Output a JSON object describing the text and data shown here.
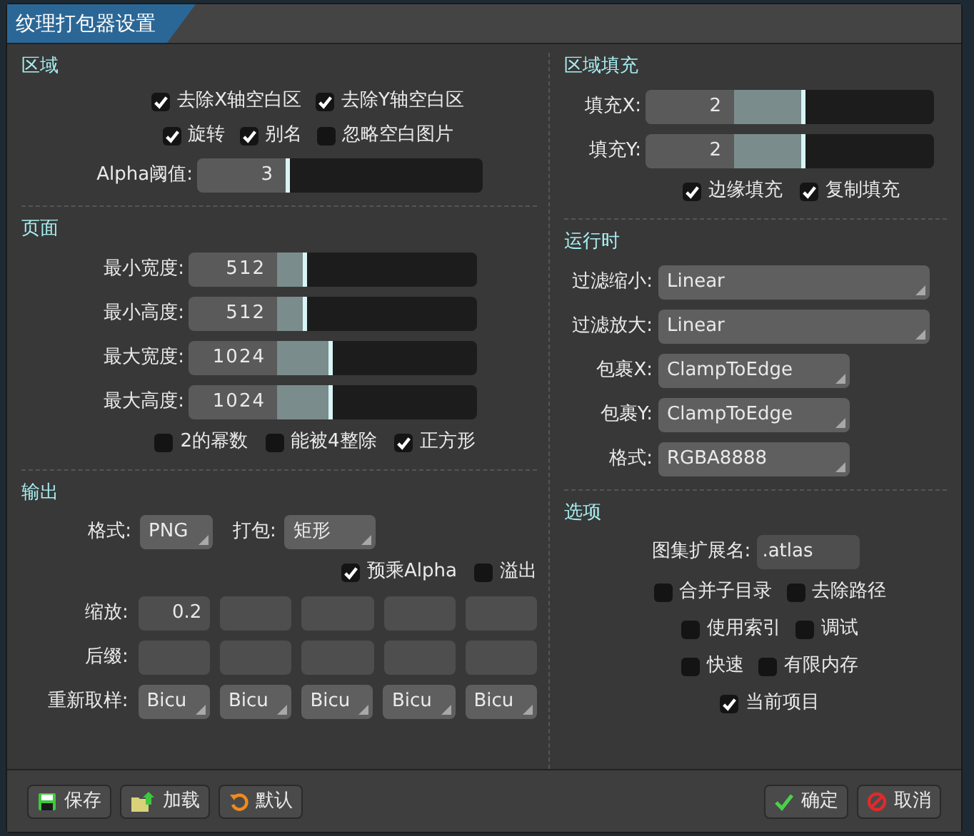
{
  "window": {
    "title": "纹理打包器设置"
  },
  "region": {
    "title": "区域",
    "checkbox_rows": [
      [
        {
          "label": "去除X轴空白区",
          "checked": true
        },
        {
          "label": "去除Y轴空白区",
          "checked": true
        }
      ],
      [
        {
          "label": "旋转",
          "checked": true
        },
        {
          "label": "别名",
          "checked": true
        },
        {
          "label": "忽略空白图片",
          "checked": false
        }
      ]
    ],
    "slider": {
      "label": "Alpha阈值:",
      "value": "3",
      "level": 0.02
    }
  },
  "page": {
    "title": "页面",
    "sliders": [
      {
        "label": "最小宽度:",
        "value": "512",
        "level": 0.15
      },
      {
        "label": "最小高度:",
        "value": "512",
        "level": 0.15
      },
      {
        "label": "最大宽度:",
        "value": "1024",
        "level": 0.28
      },
      {
        "label": "最大高度:",
        "value": "1024",
        "level": 0.28
      }
    ],
    "checkboxes": [
      {
        "label": "2的幂数",
        "checked": false
      },
      {
        "label": "能被4整除",
        "checked": false
      },
      {
        "label": "正方形",
        "checked": true
      }
    ]
  },
  "output": {
    "title": "输出",
    "format": {
      "label": "格式:",
      "value": "PNG"
    },
    "pack": {
      "label": "打包:",
      "value": "矩形"
    },
    "checkboxes": [
      {
        "label": "预乘Alpha",
        "checked": true
      },
      {
        "label": "溢出",
        "checked": false
      }
    ],
    "scale": {
      "label": "缩放:",
      "fields": [
        {
          "kind": "text",
          "value": "0.2"
        },
        {
          "kind": "empty"
        },
        {
          "kind": "empty"
        },
        {
          "kind": "empty"
        },
        {
          "kind": "empty"
        }
      ]
    },
    "suffix": {
      "label": "后缀:",
      "fields": [
        {
          "kind": "empty"
        },
        {
          "kind": "empty"
        },
        {
          "kind": "empty"
        },
        {
          "kind": "empty"
        },
        {
          "kind": "empty"
        }
      ]
    },
    "resample": {
      "label": "重新取样:",
      "values": [
        "Bicu",
        "Bicu",
        "Bicu",
        "Bicu",
        "Bicu"
      ]
    }
  },
  "padding": {
    "title": "区域填充",
    "sliders": [
      {
        "label": "填充X:",
        "value": "2",
        "level": 0.36
      },
      {
        "label": "填充Y:",
        "value": "2",
        "level": 0.36
      }
    ],
    "checkboxes": [
      {
        "label": "边缘填充",
        "checked": true
      },
      {
        "label": "复制填充",
        "checked": true
      }
    ]
  },
  "runtime": {
    "title": "运行时",
    "rows": [
      {
        "label": "过滤缩小:",
        "value": "Linear",
        "kind": "wide"
      },
      {
        "label": "过滤放大:",
        "value": "Linear",
        "kind": "wide"
      },
      {
        "label": "包裹X:",
        "value": "ClampToEdge",
        "kind": "narrow"
      },
      {
        "label": "包裹Y:",
        "value": "ClampToEdge",
        "kind": "narrow"
      },
      {
        "label": "格式:",
        "value": "RGBA8888",
        "kind": "narrow"
      }
    ]
  },
  "options": {
    "title": "选项",
    "extension": {
      "label": "图集扩展名:",
      "value": ".atlas"
    },
    "checkbox_rows": [
      [
        {
          "label": "合并子目录",
          "checked": false
        },
        {
          "label": "去除路径",
          "checked": false
        }
      ],
      [
        {
          "label": "使用索引",
          "checked": false
        },
        {
          "label": "调试",
          "checked": false
        }
      ],
      [
        {
          "label": "快速",
          "checked": false
        },
        {
          "label": "有限内存",
          "checked": false
        }
      ],
      [
        {
          "label": "当前项目",
          "checked": true
        }
      ]
    ]
  },
  "footer": {
    "left_buttons": [
      {
        "label": "保存",
        "kind": "save"
      },
      {
        "label": "加载",
        "kind": "load"
      },
      {
        "label": "默认",
        "kind": "reset"
      }
    ],
    "right_buttons": [
      {
        "label": "确定",
        "kind": "ok"
      },
      {
        "label": "取消",
        "kind": "cancel"
      }
    ]
  }
}
